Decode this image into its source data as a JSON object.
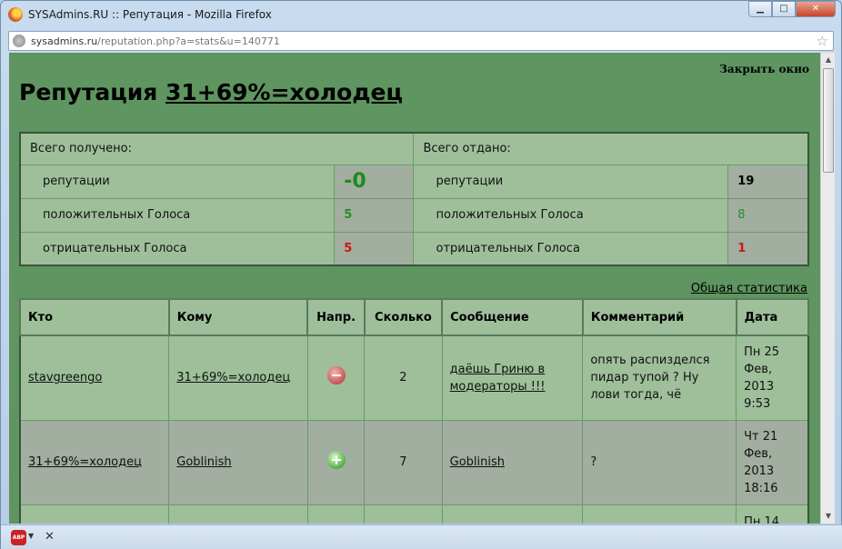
{
  "window": {
    "title": "SYSAdmins.RU :: Репутация - Mozilla Firefox",
    "min_glyph": "▁",
    "max_glyph": "□",
    "close_glyph": "✕"
  },
  "address": {
    "domain": "sysadmins.ru",
    "path": "/reputation.php?a=stats&u=140771"
  },
  "page": {
    "close_label": "Закрыть окно",
    "title_prefix": "Репутация ",
    "username": "31+69%=холодец",
    "stats_link": "Общая статистика"
  },
  "summary": {
    "received_label": "Всего получено:",
    "given_label": "Всего отдано:",
    "rows": [
      {
        "label": "репутации",
        "received": "-0",
        "given": "19"
      },
      {
        "label": "положительных Голоса",
        "received": "5",
        "given": "8"
      },
      {
        "label": "отрицательных Голоса",
        "received": "5",
        "given": "1"
      }
    ]
  },
  "votes": {
    "headers": [
      "Кто",
      "Кому",
      "Напр.",
      "Сколько",
      "Сообщение",
      "Комментарий",
      "Дата"
    ],
    "rows": [
      {
        "who": "stavgreengo",
        "to": "31+69%=холодец",
        "direction": "minus-icon",
        "amount": "2",
        "message": "даёшь Гриню в модераторы !!!",
        "comment": "опять распизделся пидар тупой ? Ну лови тогда, чё",
        "date": "Пн 25 Фев, 2013 9:53"
      },
      {
        "who": "31+69%=холодец",
        "to": "Goblinish",
        "direction": "plus-icon",
        "amount": "7",
        "message": "Goblinish",
        "comment": "?",
        "date": "Чт 21 Фев, 2013 18:16"
      },
      {
        "date": "Пн 14"
      }
    ]
  },
  "statusbar": {
    "abp_label": "ABP",
    "close_glyph": "✕"
  },
  "colors": {
    "page_bg": "#5e9560",
    "row_green": "#9ebf9a",
    "row_gray": "#a2aea0",
    "positive": "#2a8d2a",
    "negative": "#d21414"
  }
}
